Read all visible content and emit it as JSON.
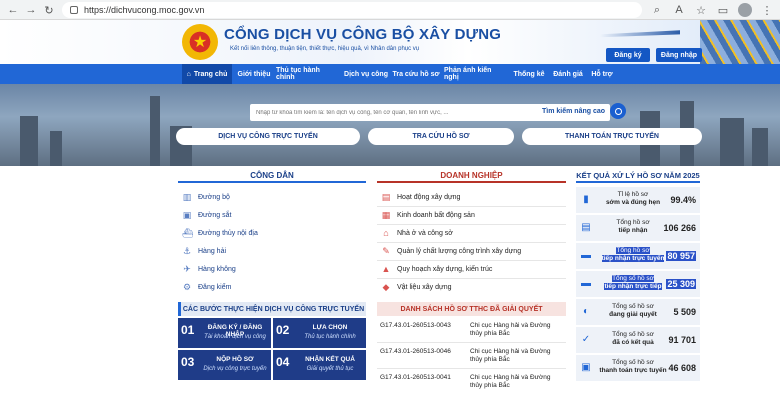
{
  "browser": {
    "url": "https://dichvucong.moc.gov.vn"
  },
  "header": {
    "title": "CỔNG DỊCH VỤ CÔNG BỘ XÂY DỰNG",
    "subtitle": "Kết nối liên thông, thuận tiện, thiết thực, hiệu quả, vì Nhân dân phục vụ",
    "register": "Đăng ký",
    "login": "Đăng nhập"
  },
  "nav": [
    "Trang chủ",
    "Giới thiệu",
    "Thủ tục hành chính",
    "Dịch vụ công",
    "Tra cứu hồ sơ",
    "Phản ánh kiến nghị",
    "Thống kê",
    "Đánh giá",
    "Hỗ trợ"
  ],
  "search": {
    "placeholder": "Nhập từ khóa tìm kiếm lá: tên dịch vụ công, tên cơ quan, tên lĩnh vực, ...",
    "advanced": "Tìm kiếm nâng cao"
  },
  "pills": [
    "DỊCH VỤ CÔNG TRỰC TUYẾN",
    "TRA CỨU HỒ SƠ",
    "THANH TOÁN TRỰC TUYẾN"
  ],
  "cong_dan": {
    "title": "CÔNG DÂN",
    "items": [
      "Đường bộ",
      "Đường sắt",
      "Đường thủy nội địa",
      "Hàng hải",
      "Hàng không",
      "Đăng kiểm"
    ]
  },
  "doanh_nghiep": {
    "title": "DOANH NGHIỆP",
    "items": [
      "Hoạt động xây dựng",
      "Kinh doanh bất động sản",
      "Nhà ở và công sở",
      "Quản lý chất lượng công trình xây dựng",
      "Quy hoạch xây dựng, kiến trúc",
      "Vật liệu xây dựng"
    ]
  },
  "steps": {
    "title": "CÁC BƯỚC THỰC HIỆN DỊCH VỤ CÔNG TRỰC TUYẾN",
    "items": [
      {
        "num": "01",
        "t1": "ĐĂNG KÝ / ĐĂNG NHẬP",
        "t2": "Tài khoản dịch vụ công"
      },
      {
        "num": "02",
        "t1": "LỰA CHỌN",
        "t2": "Thủ tục hành chính"
      },
      {
        "num": "03",
        "t1": "NỘP HỒ SƠ",
        "t2": "Dịch vụ công trực tuyến"
      },
      {
        "num": "04",
        "t1": "NHẬN KẾT QUẢ",
        "t2": "Giải quyết thủ tục"
      }
    ]
  },
  "danh_sach": {
    "title": "DANH SÁCH HỒ SƠ TTHC ĐÃ GIẢI QUYẾT",
    "rows": [
      {
        "code": "G17.43.01-260513-0043",
        "org": "Chi cục Hàng hải và Đường thủy phía Bắc"
      },
      {
        "code": "G17.43.01-260513-0046",
        "org": "Chi cục Hàng hải và Đường thủy phía Bắc"
      },
      {
        "code": "G17.43.01-260513-0041",
        "org": "Chi cục Hàng hải và Đường thủy phía Bắc"
      }
    ]
  },
  "ket_qua": {
    "title": "KẾT QUẢ XỬ LÝ HỒ SƠ NĂM 2025",
    "rows": [
      {
        "l1": "Tỉ lệ hồ sơ",
        "l2": "sớm và đúng hẹn",
        "value": "99.4%"
      },
      {
        "l1": "Tổng hồ sơ",
        "l2": "tiếp nhận",
        "value": "106 266"
      },
      {
        "l1": "Tổng hồ sơ",
        "l2": "tiếp nhận trực tuyến",
        "value": "80 957"
      },
      {
        "l1": "Tổng số hồ sơ",
        "l2": "tiếp nhận trực tiếp",
        "value": "25 309"
      },
      {
        "l1": "Tổng số hồ sơ",
        "l2": "đang giải quyết",
        "value": "5 509"
      },
      {
        "l1": "Tổng số hồ sơ",
        "l2": "đã có kết quả",
        "value": "91 701"
      },
      {
        "l1": "Tổng số hồ sơ",
        "l2": "thanh toán trực tuyến",
        "value": "46 608"
      }
    ]
  }
}
